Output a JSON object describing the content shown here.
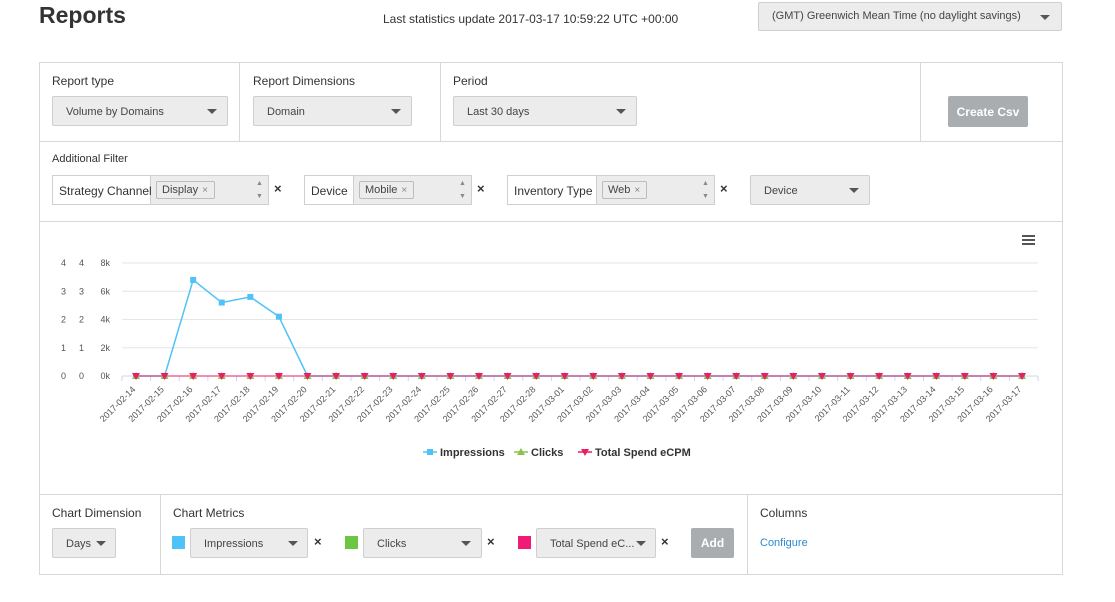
{
  "header": {
    "title": "Reports",
    "last_update": "Last statistics update 2017-03-17 10:59:22 UTC +00:00",
    "timezone": "(GMT) Greenwich Mean Time (no daylight savings)"
  },
  "report_controls": {
    "report_type_label": "Report type",
    "report_type_value": "Volume by Domains",
    "dimensions_label": "Report Dimensions",
    "dimensions_value": "Domain",
    "period_label": "Period",
    "period_value": "Last 30 days",
    "create_csv": "Create Csv"
  },
  "filters": {
    "label": "Additional Filter",
    "items": [
      {
        "label": "Strategy Channel",
        "chip": "Display"
      },
      {
        "label": "Device",
        "chip": "Mobile"
      },
      {
        "label": "Inventory Type",
        "chip": "Web"
      }
    ],
    "add_select": "Device",
    "chip_remove": "×",
    "remove": "×",
    "spin_up": "▲",
    "spin_down": "▼"
  },
  "chart_data": {
    "type": "line",
    "x": [
      "2017-02-14",
      "2017-02-15",
      "2017-02-16",
      "2017-02-17",
      "2017-02-18",
      "2017-02-19",
      "2017-02-20",
      "2017-02-21",
      "2017-02-22",
      "2017-02-23",
      "2017-02-24",
      "2017-02-25",
      "2017-02-26",
      "2017-02-27",
      "2017-02-28",
      "2017-03-01",
      "2017-03-02",
      "2017-03-03",
      "2017-03-04",
      "2017-03-05",
      "2017-03-06",
      "2017-03-07",
      "2017-03-08",
      "2017-03-09",
      "2017-03-10",
      "2017-03-11",
      "2017-03-12",
      "2017-03-13",
      "2017-03-14",
      "2017-03-15",
      "2017-03-16",
      "2017-03-17"
    ],
    "series": [
      {
        "name": "Impressions",
        "color": "#4fc3f7",
        "marker": "square",
        "axis": "left-1",
        "values": [
          0,
          0,
          6800,
          5200,
          5600,
          4200,
          0,
          0,
          0,
          0,
          0,
          0,
          0,
          0,
          0,
          0,
          0,
          0,
          0,
          0,
          0,
          0,
          0,
          0,
          0,
          0,
          0,
          0,
          0,
          0,
          0,
          0
        ]
      },
      {
        "name": "Clicks",
        "color": "#8bc34a",
        "marker": "triangle",
        "axis": "left-2",
        "values": [
          0,
          0,
          0,
          0,
          0,
          0,
          0,
          0,
          0,
          0,
          0,
          0,
          0,
          0,
          0,
          0,
          0,
          0,
          0,
          0,
          0,
          0,
          0,
          0,
          0,
          0,
          0,
          0,
          0,
          0,
          0,
          0
        ]
      },
      {
        "name": "Total Spend eCPM",
        "color": "#e91e63",
        "marker": "triangle-down",
        "axis": "left-3",
        "values": [
          0,
          0,
          0,
          0,
          0,
          0,
          0,
          0,
          0,
          0,
          0,
          0,
          0,
          0,
          0,
          0,
          0,
          0,
          0,
          0,
          0,
          0,
          0,
          0,
          0,
          0,
          0,
          0,
          0,
          0,
          0,
          0
        ]
      }
    ],
    "y_axes": [
      {
        "ticks": [
          "0",
          "1",
          "2",
          "3",
          "4"
        ],
        "range": [
          0,
          4
        ]
      },
      {
        "ticks": [
          "0",
          "1",
          "2",
          "3",
          "4"
        ],
        "range": [
          0,
          4
        ]
      },
      {
        "ticks": [
          "0k",
          "2k",
          "4k",
          "6k",
          "8k"
        ],
        "range": [
          0,
          8000
        ]
      }
    ],
    "grid": true,
    "legend_position": "bottom-center"
  },
  "chart_settings": {
    "dimension_label": "Chart Dimension",
    "dimension_value": "Days",
    "metrics_label": "Chart Metrics",
    "metrics": [
      {
        "value": "Impressions",
        "color": "#4fc3f7"
      },
      {
        "value": "Clicks",
        "color": "#6cc644"
      },
      {
        "value": "Total Spend eC...",
        "color": "#ef1b75"
      }
    ],
    "add": "Add",
    "columns_label": "Columns",
    "configure": "Configure"
  }
}
